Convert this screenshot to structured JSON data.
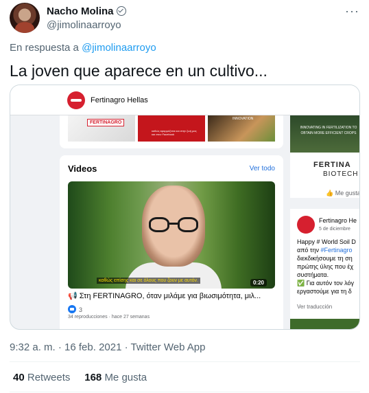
{
  "author": {
    "name": "Nacho Molina",
    "handle": "@jimolinaarroyo"
  },
  "reply": {
    "prefix": "En respuesta a",
    "to": "@jimolinaarroyo"
  },
  "tweet": {
    "text": "La joven que aparece en un cultivo..."
  },
  "embed": {
    "page_name": "Fertinagro Hellas",
    "photo1_label": "FERTINAGRO",
    "photo2_text": "καθώς εφαρμόζεται και στην ζωή μας και στον Facebook",
    "photo3_label": "INNOVATION",
    "videos_heading": "Videos",
    "see_all": "Ver todo",
    "video_subtitle": "καθώς επίσης και σε όλους που ζουν με αυτόν.",
    "video_duration": "0:20",
    "video_title": "📢 Στη FERTINAGRO, όταν μιλάμε για βιωσιμότητα, μιλ...",
    "video_likes": "3",
    "video_views": "34 reproducciones · hace 27 semanas",
    "right_image_text": "INNOVATING IN FERTILIZATION TO OBTAIN MORE EFFICIENT CROPS",
    "right_brand_1": "FERTINA",
    "right_brand_2": "BIOTECH",
    "right_like": "Me gusta",
    "post_name": "Fertinagro He",
    "post_date": "5 de diciembre",
    "post_text_1": "Happy # World Soil D",
    "post_text_2": "από την ",
    "post_hashtag": "#Fertinagro",
    "post_text_3": "διεκδικήσουμε τη ση",
    "post_text_4": "πρώτης ύλης που έχ",
    "post_text_5": "συστήματα.",
    "post_text_6": "✅ Για αυτόν τον λόγ",
    "post_text_7": "εργαστούμε για τη δ",
    "post_translate": "Ver traducción"
  },
  "meta": {
    "timestamp": "9:32 a. m. · 16 feb. 2021 · Twitter Web App"
  },
  "stats": {
    "retweets_count": "40",
    "retweets_label": "Retweets",
    "likes_count": "168",
    "likes_label": "Me gusta"
  },
  "colors": {
    "link": "#1d9bf0",
    "muted": "#536471",
    "brand_red": "#d6202f",
    "facebook_blue": "#216fdb"
  }
}
